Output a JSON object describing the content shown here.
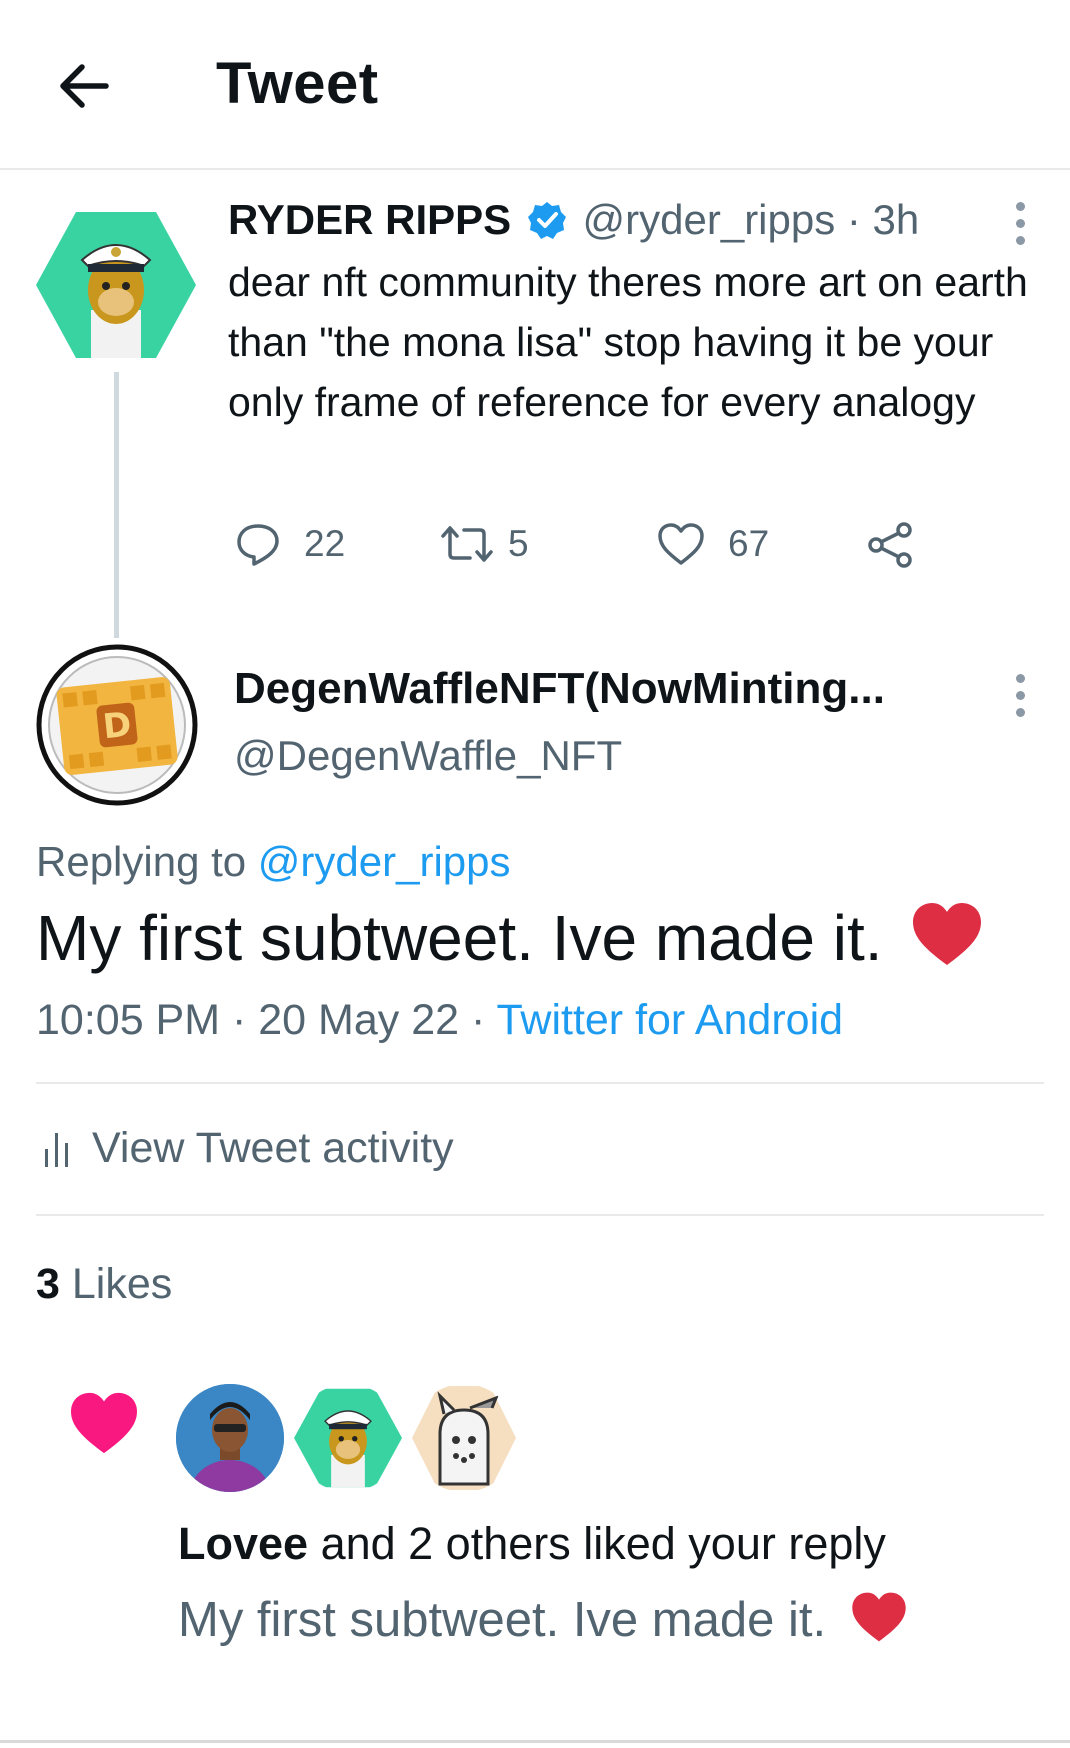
{
  "header": {
    "title": "Tweet"
  },
  "parent_tweet": {
    "author_name": "RYDER RIPPS",
    "handle": "@ryder_ripps",
    "time": "· 3h",
    "text": "dear nft community theres more art on earth than \"the mona lisa\" stop having it be your only frame of reference for every analogy",
    "replies": "22",
    "retweets": "5",
    "likes": "67"
  },
  "reply_tweet": {
    "author_name": "DegenWaffleNFT(NowMinting...",
    "handle": "@DegenWaffle_NFT",
    "replying_prefix": "Replying to",
    "replying_handle": "@ryder_ripps",
    "text": "My first subtweet. Ive made it.",
    "timestamp": "10:05 PM · 20 May 22 ·",
    "client": "Twitter for Android",
    "activity_label": "View Tweet activity",
    "likes_count": "3",
    "likes_label": "Likes"
  },
  "notification": {
    "liker": "Lovee",
    "text": " and 2 others liked your reply",
    "reply_text": "My first subtweet. Ive made it."
  },
  "colors": {
    "accent": "#1d9bf0",
    "heart_red": "#e0245e",
    "heart_pink": "#f91880",
    "muted": "#536471"
  }
}
